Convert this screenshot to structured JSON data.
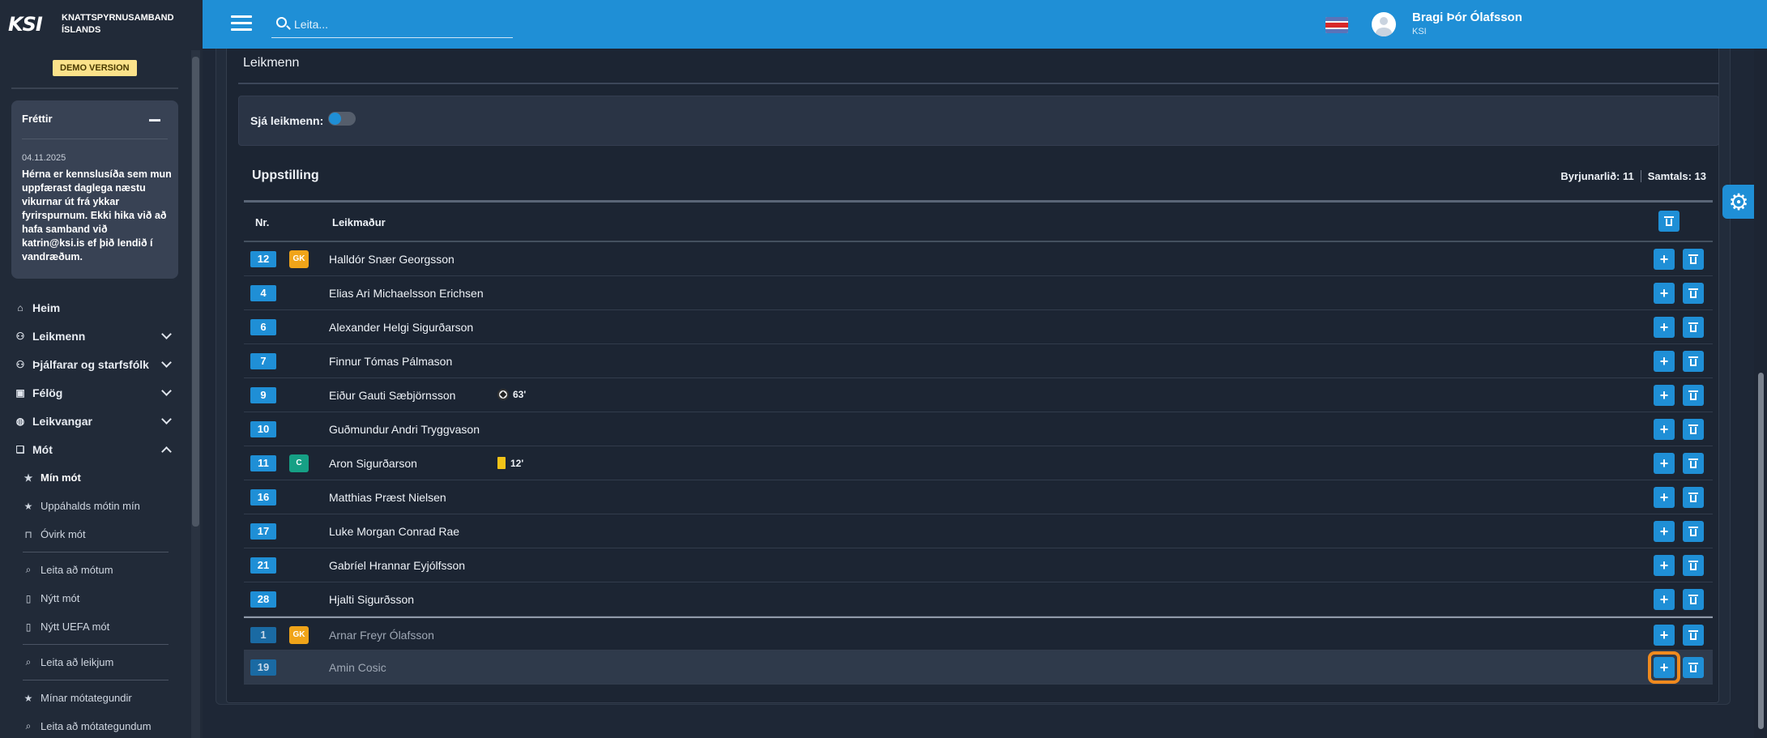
{
  "brand": {
    "logo": "KSI",
    "name_line1": "KNATTSPYRNUSAMBAND",
    "name_line2": "ÍSLANDS"
  },
  "demo_label": "DEMO VERSION",
  "news": {
    "title": "Fréttir",
    "date": "04.11.2025",
    "body": "Hérna er kennslusíða sem mun uppfærast daglega næstu vikurnar út frá ykkar fyrirspurnum. Ekki hika við að hafa samband við katrin@ksi.is ef þið lendið í vandræðum."
  },
  "nav": {
    "home": "Heim",
    "players": "Leikmenn",
    "coaches": "Þjálfarar og starfsfólk",
    "clubs": "Félög",
    "venues": "Leikvangar",
    "tournaments": "Mót",
    "sub": {
      "my_tournaments": "Mín mót",
      "favourite_tournaments": "Uppáhalds mótin mín",
      "inactive_tournaments": "Óvirk mót",
      "search_tournaments": "Leita að mótum",
      "new_tournament": "Nýtt mót",
      "new_uefa_tournament": "Nýtt UEFA mót",
      "search_matches": "Leita að leikjum",
      "my_tournament_types": "Mínar mótategundir",
      "search_tournament_types": "Leita að mótategundum"
    }
  },
  "topbar": {
    "search_placeholder": "Leita...",
    "user_name": "Bragi Þór Ólafsson",
    "user_org": "KSI"
  },
  "section": {
    "title": "Leikmenn",
    "toggle_label": "Sjá leikmenn:"
  },
  "lineup": {
    "title": "Uppstilling",
    "starting_label": "Byrjunarlið: 11",
    "total_label": "Samtals: 13",
    "columns": {
      "number": "Nr.",
      "player": "Leikmaður"
    },
    "players": [
      {
        "number": "12",
        "badge": "GK",
        "name": "Halldór Snær Georgsson",
        "event": "",
        "event_type": ""
      },
      {
        "number": "4",
        "badge": "",
        "name": "Elias Ari Michaelsson Erichsen",
        "event": "",
        "event_type": ""
      },
      {
        "number": "6",
        "badge": "",
        "name": "Alexander Helgi Sigurðarson",
        "event": "",
        "event_type": ""
      },
      {
        "number": "7",
        "badge": "",
        "name": "Finnur Tómas Pálmason",
        "event": "",
        "event_type": ""
      },
      {
        "number": "9",
        "badge": "",
        "name": "Eiður Gauti Sæbjörnsson",
        "event": "63'",
        "event_type": "goal"
      },
      {
        "number": "10",
        "badge": "",
        "name": "Guðmundur Andri Tryggvason",
        "event": "",
        "event_type": ""
      },
      {
        "number": "11",
        "badge": "C",
        "name": "Aron Sigurðarson",
        "event": "12'",
        "event_type": "yellow-card"
      },
      {
        "number": "16",
        "badge": "",
        "name": "Matthias Præst Nielsen",
        "event": "",
        "event_type": ""
      },
      {
        "number": "17",
        "badge": "",
        "name": "Luke Morgan Conrad Rae",
        "event": "",
        "event_type": ""
      },
      {
        "number": "21",
        "badge": "",
        "name": "Gabríel Hrannar Eyjólfsson",
        "event": "",
        "event_type": ""
      },
      {
        "number": "28",
        "badge": "",
        "name": "Hjalti Sigurðsson",
        "event": "",
        "event_type": ""
      }
    ],
    "substitutes": [
      {
        "number": "1",
        "badge": "GK",
        "name": "Arnar Freyr Ólafsson"
      },
      {
        "number": "19",
        "badge": "",
        "name": "Amin Cosic"
      }
    ]
  },
  "colors": {
    "accent": "#1f8fd6",
    "focus": "#f08a1e",
    "gk": "#f0a419",
    "captain": "#16a085"
  }
}
